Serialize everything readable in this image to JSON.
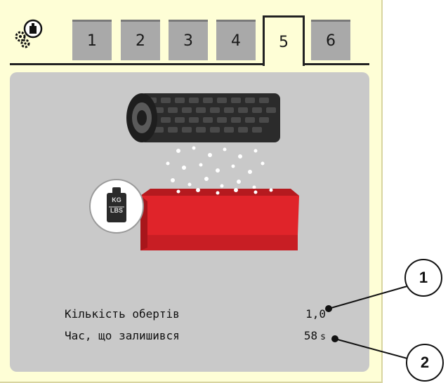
{
  "tabs": [
    {
      "label": "1",
      "active": false
    },
    {
      "label": "2",
      "active": false
    },
    {
      "label": "3",
      "active": false
    },
    {
      "label": "4",
      "active": false
    },
    {
      "label": "5",
      "active": true
    },
    {
      "label": "6",
      "active": false
    }
  ],
  "header_icon": "scale-calibration-icon",
  "illustration": {
    "weight_label_top": "KG",
    "weight_label_bottom": "LBS"
  },
  "rows": {
    "revolutions_label": "Кількість обертів",
    "revolutions_value": "1,0",
    "time_label": "Час, що залишився",
    "time_value": "58",
    "time_unit": "s"
  },
  "callouts": [
    "1",
    "2"
  ],
  "colors": {
    "screen_background": "#fefed6",
    "panel_background": "#c9c9c9",
    "tab_inactive": "#a9a9a9",
    "tray_red": "#e0242a"
  }
}
